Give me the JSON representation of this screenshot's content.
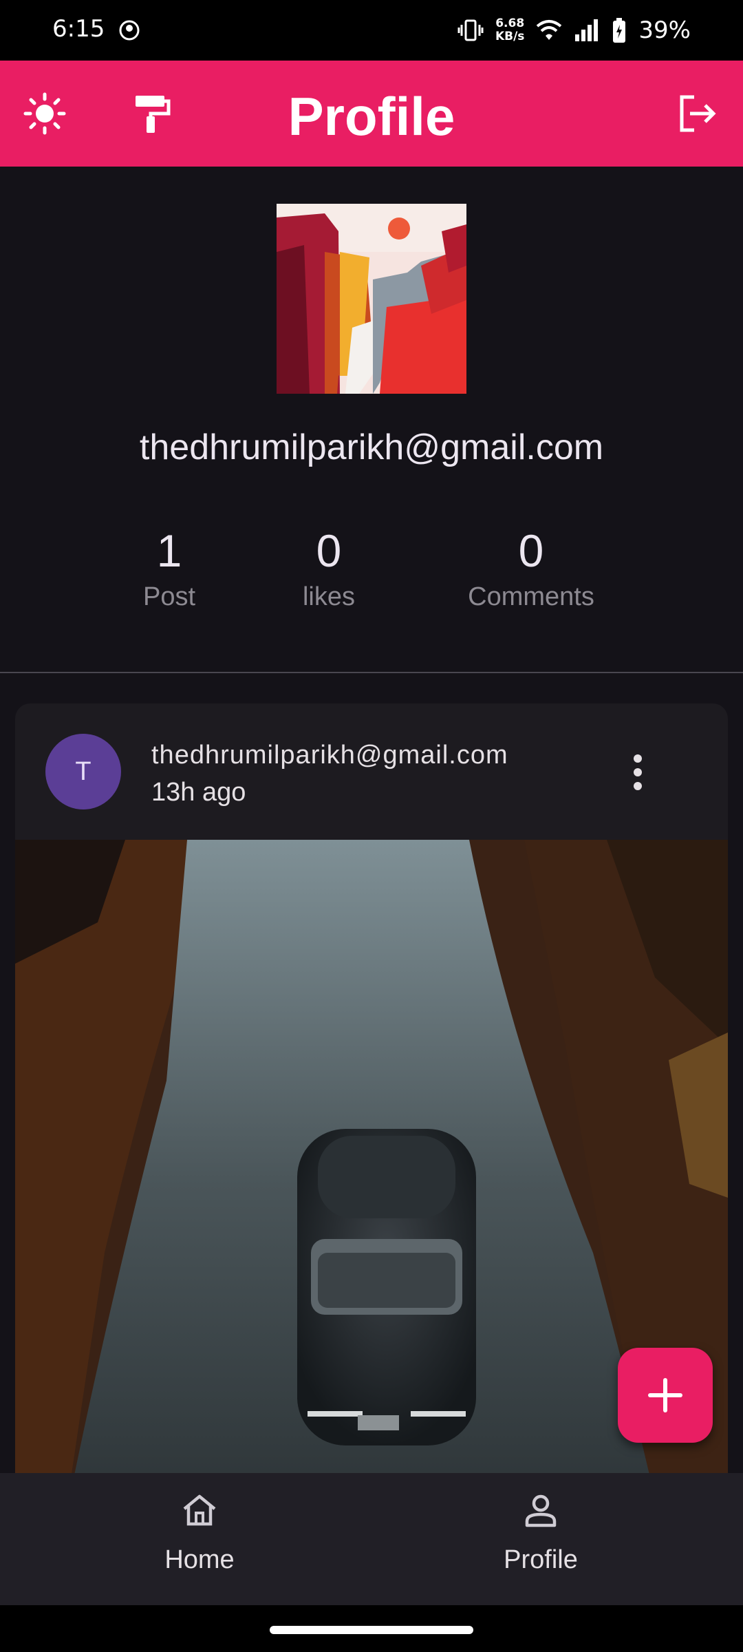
{
  "status_bar": {
    "time": "6:15",
    "network_speed_value": "6.68",
    "network_speed_unit": "KB/s",
    "battery_percent": "39%",
    "icons": [
      "vibrate-icon",
      "wifi-icon",
      "signal-icon",
      "battery-icon"
    ]
  },
  "app_bar": {
    "title": "Profile",
    "background_color": "#e91e63",
    "left_icons": [
      "brightness-icon",
      "paint-roller-icon"
    ],
    "right_icons": [
      "logout-icon"
    ]
  },
  "profile": {
    "email": "thedhrumilparikh@gmail.com",
    "stats": [
      {
        "value": "1",
        "label": "Post"
      },
      {
        "value": "0",
        "label": "likes"
      },
      {
        "value": "0",
        "label": "Comments"
      }
    ]
  },
  "post": {
    "avatar_initial": "T",
    "author": "thedhrumilparikh@gmail.com",
    "time": "13h ago"
  },
  "fab": {
    "icon": "add-icon"
  },
  "bottom_nav": {
    "items": [
      {
        "label": "Home",
        "icon": "home-icon"
      },
      {
        "label": "Profile",
        "icon": "person-icon"
      }
    ]
  }
}
